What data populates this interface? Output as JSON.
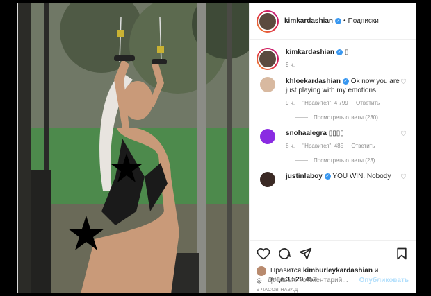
{
  "header": {
    "username": "kimkardashian",
    "separator": "•",
    "follow_label": "Подписки"
  },
  "caption": {
    "username": "kimkardashian",
    "text": "▯",
    "time": "9 ч."
  },
  "comments": [
    {
      "username": "khloekardashian",
      "text": "Ok now you are just playing with my emotions",
      "time": "9 ч.",
      "likes": "\"Нравится\": 4 799",
      "reply_label": "Ответить",
      "view_replies": "Посмотреть ответы (230)"
    },
    {
      "username": "snohaalegra",
      "text": "▯▯▯▯",
      "time": "8 ч.",
      "likes": "\"Нравится\": 485",
      "reply_label": "Ответить",
      "view_replies": "Посмотреть ответы (23)"
    },
    {
      "username": "justinlaboy",
      "text": "YOU WIN. Nobody"
    }
  ],
  "likes": {
    "prefix": "Нравится",
    "user": "kimburleykardashian",
    "connector": "и",
    "line2": "ещё 3 520 452"
  },
  "time_ago": "9 ЧАСОВ НАЗАД",
  "add_comment": {
    "placeholder": "Добавьте комментарий...",
    "post_label": "Опубликовать"
  },
  "icons": {
    "like": "heart-icon",
    "comment": "comment-icon",
    "share": "share-icon",
    "save": "bookmark-icon",
    "emoji": "emoji-icon"
  },
  "colors": {
    "verified": "#3897f0",
    "post_button": "#b2dffc",
    "snohaalegra_avatar": "#8a2be2"
  }
}
